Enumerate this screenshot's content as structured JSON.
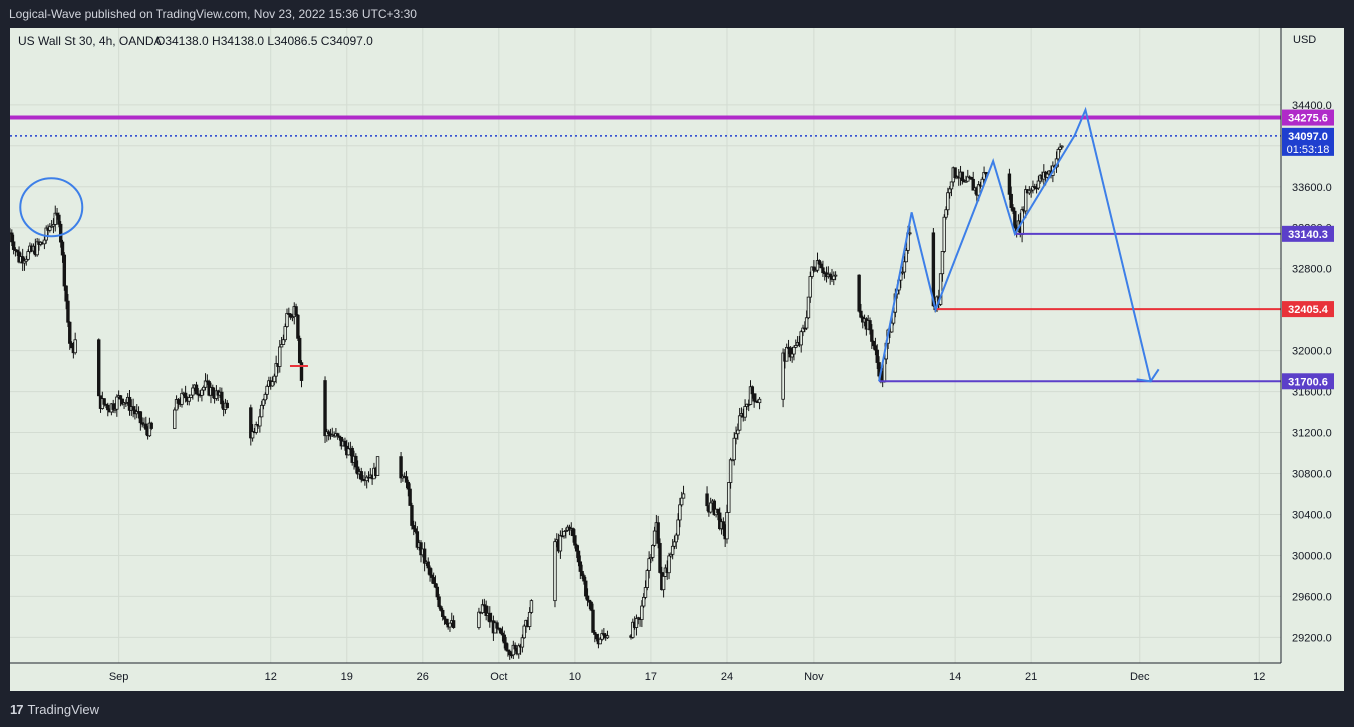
{
  "header": {
    "publish_line": "Logical-Wave published on TradingView.com, Nov 23, 2022 15:36 UTC+3:30"
  },
  "footer": {
    "logo_mark": "17",
    "logo_text": "TradingView"
  },
  "colors": {
    "background": "#e4ede3",
    "frame": "#1e222d",
    "candle": "#151515",
    "drawing_blue": "#3d7fe8",
    "magenta": "#b02ac9",
    "red": "#e8323a",
    "purple": "#5b3fc9",
    "price_dotted": "#1f3fcf"
  },
  "chart_data": {
    "type": "candlestick",
    "title": "US Wall St 30, 4h, OANDA",
    "ohlc_label": "O34138.0  H34138.0  L34086.5  C34097.0",
    "currency": "USD",
    "ylim": [
      28950,
      35150
    ],
    "yticks": [
      29200,
      29600,
      30000,
      30400,
      30800,
      31200,
      31600,
      32000,
      32400,
      32800,
      33200,
      33600,
      34000,
      34400
    ],
    "ytick_labels": [
      "29200.0",
      "29600.0",
      "30000.0",
      "30400.0",
      "30800.0",
      "31200.0",
      "31600.0",
      "32000.0",
      "32400.0",
      "32800.0",
      "33200.0",
      "33600.0",
      "34000.0",
      "34400.0"
    ],
    "x_labels": [
      {
        "label": "Sep",
        "day": 7
      },
      {
        "label": "12",
        "day": 21
      },
      {
        "label": "19",
        "day": 28
      },
      {
        "label": "26",
        "day": 35
      },
      {
        "label": "Oct",
        "day": 42
      },
      {
        "label": "10",
        "day": 49
      },
      {
        "label": "17",
        "day": 56
      },
      {
        "label": "24",
        "day": 63
      },
      {
        "label": "Nov",
        "day": 71
      },
      {
        "label": "14",
        "day": 84
      },
      {
        "label": "21",
        "day": 91
      },
      {
        "label": "Dec",
        "day": 101
      },
      {
        "label": "12",
        "day": 112
      }
    ],
    "x_domain_days": [
      -3,
      114
    ],
    "date_origin": "Aug 25, 2022",
    "close_path": [
      {
        "d": -3,
        "p": 33150
      },
      {
        "d": -2.2,
        "p": 32900
      },
      {
        "d": -1.2,
        "p": 32950
      },
      {
        "d": 0,
        "p": 33050
      },
      {
        "d": 0.8,
        "p": 33250
      },
      {
        "d": 1.5,
        "p": 33300
      },
      {
        "d": 2.0,
        "p": 32700
      },
      {
        "d": 2.6,
        "p": 31950
      },
      {
        "d": 3.5,
        "p": 32250
      },
      {
        "d": 4.3,
        "p": 31850
      },
      {
        "d": 5.2,
        "p": 31500
      },
      {
        "d": 6.2,
        "p": 31450
      },
      {
        "d": 7.2,
        "p": 31550
      },
      {
        "d": 8.2,
        "p": 31450
      },
      {
        "d": 9.3,
        "p": 31250
      },
      {
        "d": 10.3,
        "p": 31200
      },
      {
        "d": 11.3,
        "p": 31200
      },
      {
        "d": 12.5,
        "p": 31500
      },
      {
        "d": 13.8,
        "p": 31600
      },
      {
        "d": 15.0,
        "p": 31650
      },
      {
        "d": 16.2,
        "p": 31550
      },
      {
        "d": 17.5,
        "p": 31350
      },
      {
        "d": 18.8,
        "p": 31250
      },
      {
        "d": 19.5,
        "p": 31150
      },
      {
        "d": 20.5,
        "p": 31600
      },
      {
        "d": 21.7,
        "p": 31900
      },
      {
        "d": 22.5,
        "p": 32300
      },
      {
        "d": 23.3,
        "p": 32450
      },
      {
        "d": 23.8,
        "p": 31750
      },
      {
        "d": 24.3,
        "p": 31300
      },
      {
        "d": 25.5,
        "p": 31150
      },
      {
        "d": 26.5,
        "p": 31200
      },
      {
        "d": 28.0,
        "p": 31050
      },
      {
        "d": 29.2,
        "p": 30800
      },
      {
        "d": 30.5,
        "p": 30800
      },
      {
        "d": 31.2,
        "p": 31000
      },
      {
        "d": 32.2,
        "p": 30650
      },
      {
        "d": 33.3,
        "p": 30850
      },
      {
        "d": 34.2,
        "p": 30200
      },
      {
        "d": 35.0,
        "p": 30000
      },
      {
        "d": 36.0,
        "p": 29700
      },
      {
        "d": 37.0,
        "p": 29400
      },
      {
        "d": 38.2,
        "p": 29250
      },
      {
        "d": 39.3,
        "p": 29100
      },
      {
        "d": 40.5,
        "p": 29500
      },
      {
        "d": 41.5,
        "p": 29300
      },
      {
        "d": 42.5,
        "p": 29150
      },
      {
        "d": 43.5,
        "p": 29050
      },
      {
        "d": 44.5,
        "p": 29300
      },
      {
        "d": 45.5,
        "p": 29700
      },
      {
        "d": 46.5,
        "p": 30200
      },
      {
        "d": 47.5,
        "p": 30100
      },
      {
        "d": 48.5,
        "p": 30300
      },
      {
        "d": 49.5,
        "p": 29900
      },
      {
        "d": 50.3,
        "p": 29500
      },
      {
        "d": 51.0,
        "p": 29150
      },
      {
        "d": 52.0,
        "p": 29250
      },
      {
        "d": 53.0,
        "p": 29300
      },
      {
        "d": 54.0,
        "p": 29250
      },
      {
        "d": 55.0,
        "p": 29350
      },
      {
        "d": 55.7,
        "p": 29900
      },
      {
        "d": 56.5,
        "p": 30300
      },
      {
        "d": 57.0,
        "p": 29700
      },
      {
        "d": 57.8,
        "p": 30000
      },
      {
        "d": 58.5,
        "p": 30350
      },
      {
        "d": 59.2,
        "p": 30700
      },
      {
        "d": 60.0,
        "p": 30600
      },
      {
        "d": 61.0,
        "p": 30500
      },
      {
        "d": 62.0,
        "p": 30450
      },
      {
        "d": 62.8,
        "p": 30150
      },
      {
        "d": 63.3,
        "p": 30850
      },
      {
        "d": 63.8,
        "p": 31200
      },
      {
        "d": 64.5,
        "p": 31400
      },
      {
        "d": 65.2,
        "p": 31600
      },
      {
        "d": 66.0,
        "p": 31500
      },
      {
        "d": 66.7,
        "p": 31650
      },
      {
        "d": 67.5,
        "p": 31850
      },
      {
        "d": 68.3,
        "p": 31950
      },
      {
        "d": 69.0,
        "p": 32000
      },
      {
        "d": 69.6,
        "p": 32050
      },
      {
        "d": 70.2,
        "p": 32250
      },
      {
        "d": 70.8,
        "p": 32800
      },
      {
        "d": 71.5,
        "p": 32900
      },
      {
        "d": 72.2,
        "p": 32700
      },
      {
        "d": 73.0,
        "p": 32700
      },
      {
        "d": 73.8,
        "p": 32850
      },
      {
        "d": 74.4,
        "p": 32800
      },
      {
        "d": 75.0,
        "p": 32500
      },
      {
        "d": 75.6,
        "p": 32300
      },
      {
        "d": 76.2,
        "p": 32200
      },
      {
        "d": 76.8,
        "p": 31900
      },
      {
        "d": 77.3,
        "p": 31700
      },
      {
        "d": 77.8,
        "p": 32150
      },
      {
        "d": 78.3,
        "p": 32400
      },
      {
        "d": 79.0,
        "p": 32700
      },
      {
        "d": 79.6,
        "p": 33100
      },
      {
        "d": 80.0,
        "p": 33300
      },
      {
        "d": 80.5,
        "p": 33250
      },
      {
        "d": 81.0,
        "p": 33000
      },
      {
        "d": 81.5,
        "p": 32800
      },
      {
        "d": 82.0,
        "p": 32400
      },
      {
        "d": 82.5,
        "p": 32500
      },
      {
        "d": 83.0,
        "p": 33300
      },
      {
        "d": 83.6,
        "p": 33700
      },
      {
        "d": 84.2,
        "p": 33750
      },
      {
        "d": 84.8,
        "p": 33600
      },
      {
        "d": 85.4,
        "p": 33650
      },
      {
        "d": 86.0,
        "p": 33550
      },
      {
        "d": 86.6,
        "p": 33700
      },
      {
        "d": 87.2,
        "p": 33850
      },
      {
        "d": 87.8,
        "p": 33550
      },
      {
        "d": 88.4,
        "p": 33450
      },
      {
        "d": 89.0,
        "p": 33500
      },
      {
        "d": 89.5,
        "p": 33250
      },
      {
        "d": 90.0,
        "p": 33200
      },
      {
        "d": 90.5,
        "p": 33550
      },
      {
        "d": 91.0,
        "p": 33600
      },
      {
        "d": 91.6,
        "p": 33650
      },
      {
        "d": 92.2,
        "p": 33700
      },
      {
        "d": 92.8,
        "p": 33750
      },
      {
        "d": 93.4,
        "p": 33900
      },
      {
        "d": 94.0,
        "p": 34050
      },
      {
        "d": 94.6,
        "p": 34100
      },
      {
        "d": 95.0,
        "p": 34097
      }
    ],
    "horizontal_levels": [
      {
        "price": 34275.6,
        "label": "34275.6",
        "color": "#b02ac9",
        "from_day": -3
      },
      {
        "price": 33140.3,
        "label": "33140.3",
        "color": "#5b3fc9",
        "from_day": 89.5
      },
      {
        "price": 32405.4,
        "label": "32405.4",
        "color": "#e8323a",
        "from_day": 82.2
      },
      {
        "price": 31700.6,
        "label": "31700.6",
        "color": "#5b3fc9",
        "from_day": 77.0
      }
    ],
    "last_price": {
      "price": 34097.0,
      "label": "34097.0",
      "countdown": "01:53:18"
    },
    "drawings": {
      "zigzag": [
        {
          "d": 77.0,
          "p": 31700
        },
        {
          "d": 80.0,
          "p": 33350
        },
        {
          "d": 82.2,
          "p": 32400
        },
        {
          "d": 87.5,
          "p": 33850
        },
        {
          "d": 89.5,
          "p": 33140
        },
        {
          "d": 95.0,
          "p": 34100
        },
        {
          "d": 96.0,
          "p": 34350
        },
        {
          "d": 102.0,
          "p": 31700
        }
      ],
      "circle_center": {
        "d": 0.8,
        "p": 33400
      },
      "marker_cross": {
        "d": 23.6,
        "p": 31850
      }
    }
  }
}
